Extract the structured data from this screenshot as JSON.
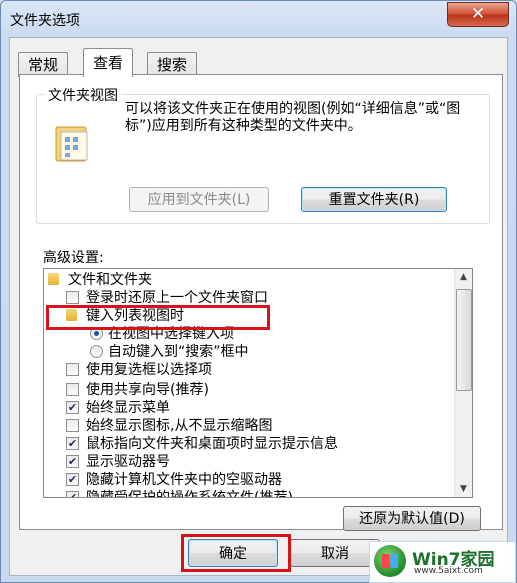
{
  "window": {
    "title": "文件夹选项",
    "close_glyph": "✕"
  },
  "tabs": [
    {
      "label": "常规",
      "active": false
    },
    {
      "label": "查看",
      "active": true
    },
    {
      "label": "搜索",
      "active": false
    }
  ],
  "folder_views": {
    "group_label": "文件夹视图",
    "description": "可以将该文件夹正在使用的视图(例如“详细信息”或“图标”)应用到所有这种类型的文件夹中。",
    "apply_button": "应用到文件夹(L)",
    "reset_button": "重置文件夹(R)"
  },
  "advanced": {
    "label": "高级设置:",
    "items": [
      {
        "kind": "folder",
        "label": "文件和文件夹",
        "indent": 0
      },
      {
        "kind": "checkbox",
        "checked": false,
        "label": "登录时还原上一个文件夹窗口",
        "indent": 1
      },
      {
        "kind": "folder",
        "label": "键入列表视图时",
        "indent": 1
      },
      {
        "kind": "radio",
        "checked": true,
        "label": "在视图中选择键入项",
        "indent": 2
      },
      {
        "kind": "radio",
        "checked": false,
        "label": "自动键入到“搜索”框中",
        "indent": 2
      },
      {
        "kind": "checkbox",
        "checked": false,
        "label": "使用复选框以选择项",
        "indent": 1
      },
      {
        "kind": "checkbox",
        "checked": false,
        "label": "使用共享向导(推荐)",
        "indent": 1
      },
      {
        "kind": "checkbox",
        "checked": true,
        "label": "始终显示菜单",
        "indent": 1
      },
      {
        "kind": "checkbox",
        "checked": false,
        "label": "始终显示图标,从不显示缩略图",
        "indent": 1
      },
      {
        "kind": "checkbox",
        "checked": true,
        "label": "鼠标指向文件夹和桌面项时显示提示信息",
        "indent": 1
      },
      {
        "kind": "checkbox",
        "checked": true,
        "label": "显示驱动器号",
        "indent": 1
      },
      {
        "kind": "checkbox",
        "checked": true,
        "label": "隐藏计算机文件夹中的空驱动器",
        "indent": 1
      },
      {
        "kind": "checkbox",
        "checked": true,
        "label": "隐藏受保护的操作系统文件(推荐)",
        "indent": 1
      }
    ],
    "restore_button": "还原为默认值(D)"
  },
  "footer": {
    "ok_button": "确定",
    "cancel_button": "取消"
  },
  "watermark": {
    "title": "Win7家园",
    "url": "www.5aixt.com"
  },
  "colors": {
    "highlight_red": "#d8121b",
    "check_mark": "#21305a"
  }
}
